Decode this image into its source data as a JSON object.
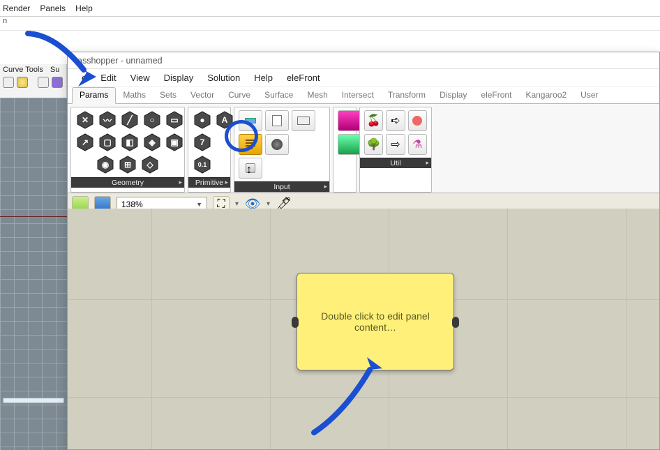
{
  "rhino_menu": {
    "render": "Render",
    "panels": "Panels",
    "help": "Help"
  },
  "rhino_bar2": "n",
  "rhino_tabs": {
    "curve": "Curve Tools",
    "surf": "Su"
  },
  "gh_title": "asshopper - unnamed",
  "gh_menu": {
    "file_tail": "e",
    "edit": "Edit",
    "view": "View",
    "display": "Display",
    "solution": "Solution",
    "help": "Help",
    "elefront": "eleFront"
  },
  "gh_tabs": {
    "params": "Params",
    "maths": "Maths",
    "sets": "Sets",
    "vector": "Vector",
    "curve": "Curve",
    "surface": "Surface",
    "mesh": "Mesh",
    "intersect": "Intersect",
    "transform": "Transform",
    "display": "Display",
    "elefront": "eleFront",
    "kangaroo": "Kangaroo2",
    "user": "User"
  },
  "ribbon": {
    "geometry": "Geometry",
    "primitive": "Primitive",
    "input": "Input",
    "util": "Util",
    "prim_labels": {
      "seven": "7",
      "a": "A",
      "zero": "0.1"
    }
  },
  "canvas_toolbar": {
    "zoom": "138%"
  },
  "panel_text": "Double click to edit panel content…"
}
